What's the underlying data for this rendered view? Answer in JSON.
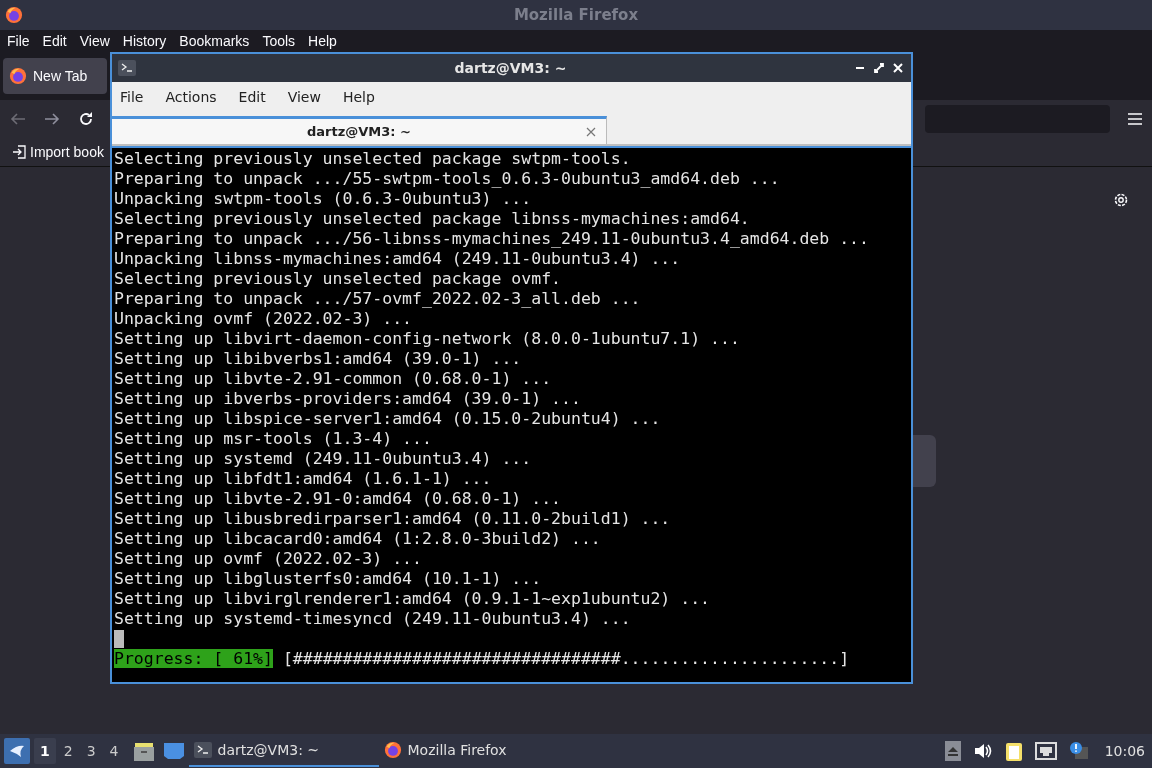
{
  "firefox": {
    "title": "Mozilla Firefox",
    "menu": [
      "File",
      "Edit",
      "View",
      "History",
      "Bookmarks",
      "Tools",
      "Help"
    ],
    "tabs": [
      {
        "label": "New Tab",
        "selected": true
      }
    ],
    "bookmarks": [
      "Import book"
    ]
  },
  "terminal": {
    "title": "dartz@VM3: ~",
    "menu": [
      "File",
      "Actions",
      "Edit",
      "View",
      "Help"
    ],
    "tabs": [
      {
        "label": "dartz@VM3: ~",
        "selected": true
      }
    ],
    "lines": [
      "Selecting previously unselected package swtpm-tools.",
      "Preparing to unpack .../55-swtpm-tools_0.6.3-0ubuntu3_amd64.deb ...",
      "Unpacking swtpm-tools (0.6.3-0ubuntu3) ...",
      "Selecting previously unselected package libnss-mymachines:amd64.",
      "Preparing to unpack .../56-libnss-mymachines_249.11-0ubuntu3.4_amd64.deb ...",
      "Unpacking libnss-mymachines:amd64 (249.11-0ubuntu3.4) ...",
      "Selecting previously unselected package ovmf.",
      "Preparing to unpack .../57-ovmf_2022.02-3_all.deb ...",
      "Unpacking ovmf (2022.02-3) ...",
      "Setting up libvirt-daemon-config-network (8.0.0-1ubuntu7.1) ...",
      "Setting up libibverbs1:amd64 (39.0-1) ...",
      "Setting up libvte-2.91-common (0.68.0-1) ...",
      "Setting up ibverbs-providers:amd64 (39.0-1) ...",
      "Setting up libspice-server1:amd64 (0.15.0-2ubuntu4) ...",
      "Setting up msr-tools (1.3-4) ...",
      "Setting up systemd (249.11-0ubuntu3.4) ...",
      "Setting up libfdt1:amd64 (1.6.1-1) ...",
      "Setting up libvte-2.91-0:amd64 (0.68.0-1) ...",
      "Setting up libusbredirparser1:amd64 (0.11.0-2build1) ...",
      "Setting up libcacard0:amd64 (1:2.8.0-3build2) ...",
      "Setting up ovmf (2022.02-3) ...",
      "Setting up libglusterfs0:amd64 (10.1-1) ...",
      "Setting up libvirglrenderer1:amd64 (0.9.1-1~exp1ubuntu2) ...",
      "Setting up systemd-timesyncd (249.11-0ubuntu3.4) ..."
    ],
    "progress": {
      "label": "Progress: [ 61%]",
      "bar": "[#################################......................]"
    }
  },
  "taskbar": {
    "workspaces": [
      {
        "label": "1",
        "selected": true
      },
      {
        "label": "2",
        "selected": false
      },
      {
        "label": "3",
        "selected": false
      },
      {
        "label": "4",
        "selected": false
      }
    ],
    "tasks": [
      {
        "label": "dartz@VM3: ~",
        "kind": "terminal",
        "selected": true
      },
      {
        "label": "Mozilla Firefox",
        "kind": "firefox",
        "selected": false
      }
    ],
    "clock": "10:06"
  }
}
